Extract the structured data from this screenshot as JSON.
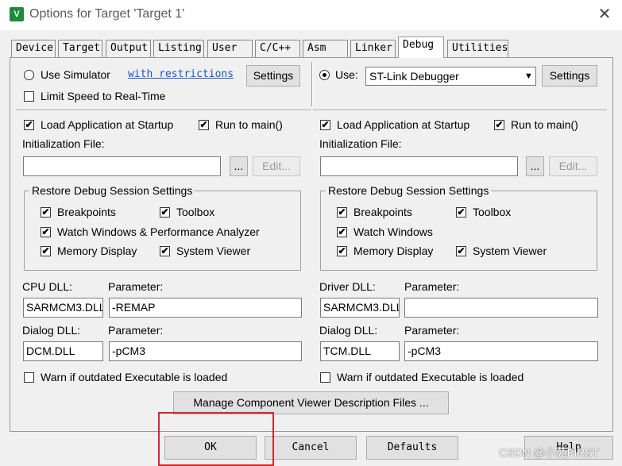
{
  "window": {
    "title": "Options for Target 'Target 1'",
    "icon": "keil-icon",
    "close": "✕"
  },
  "tabs": [
    "Device",
    "Target",
    "Output",
    "Listing",
    "User",
    "C/C++",
    "Asm",
    "Linker",
    "Debug",
    "Utilities"
  ],
  "active_tab": "Debug",
  "left": {
    "use_simulator": "Use Simulator",
    "restrictions_link": "with restrictions",
    "settings_btn": "Settings",
    "limit_speed": "Limit Speed to Real-Time",
    "load_app": "Load Application at Startup",
    "run_to_main": "Run to main()",
    "init_file_label": "Initialization File:",
    "init_file_value": "",
    "browse_btn": "...",
    "edit_btn": "Edit...",
    "restore_title": "Restore Debug Session Settings",
    "breakpoints": "Breakpoints",
    "toolbox": "Toolbox",
    "watch_windows": "Watch Windows & Performance Analyzer",
    "memory_display": "Memory Display",
    "system_viewer": "System Viewer",
    "dll_label": "CPU DLL:",
    "param_label": "Parameter:",
    "dll_value": "SARMCM3.DLL",
    "dll_param": "-REMAP",
    "dialog_dll_label": "Dialog DLL:",
    "dialog_param_label": "Parameter:",
    "dialog_dll_value": "DCM.DLL",
    "dialog_param": "-pCM3",
    "warn": "Warn if outdated Executable is loaded"
  },
  "right": {
    "use_label": "Use:",
    "debugger_value": "ST-Link Debugger",
    "settings_btn": "Settings",
    "load_app": "Load Application at Startup",
    "run_to_main": "Run to main()",
    "init_file_label": "Initialization File:",
    "init_file_value": "",
    "browse_btn": "...",
    "edit_btn": "Edit...",
    "restore_title": "Restore Debug Session Settings",
    "breakpoints": "Breakpoints",
    "toolbox": "Toolbox",
    "watch_windows": "Watch Windows",
    "memory_display": "Memory Display",
    "system_viewer": "System Viewer",
    "dll_label": "Driver DLL:",
    "param_label": "Parameter:",
    "dll_value": "SARMCM3.DLL",
    "dll_param": "",
    "dialog_dll_label": "Dialog DLL:",
    "dialog_param_label": "Parameter:",
    "dialog_dll_value": "TCM.DLL",
    "dialog_param": "-pCM3",
    "warn": "Warn if outdated Executable is loaded"
  },
  "manage_btn": "Manage Component Viewer Description Files ...",
  "footer": {
    "ok": "OK",
    "cancel": "Cancel",
    "defaults": "Defaults",
    "help": "Help"
  },
  "watermark": "CSDN @小苑FIRST",
  "check_mark": "✔",
  "combo_arrow": "▼",
  "colors": {
    "highlight_box": "#d62828",
    "link": "#1a55d4"
  }
}
